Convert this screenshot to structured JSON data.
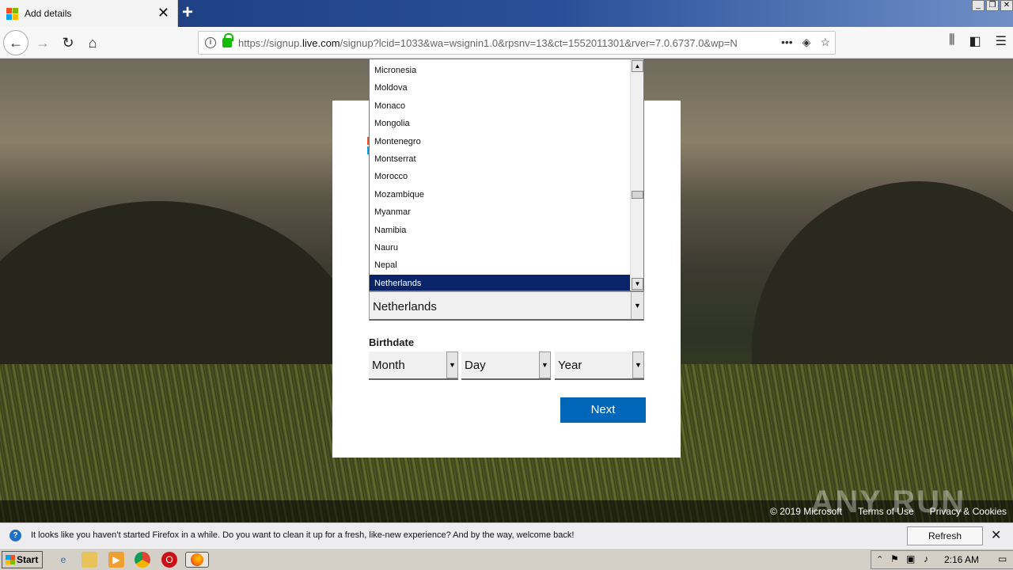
{
  "browser": {
    "tab_title": "Add details",
    "url_prefix": "https://signup.",
    "url_domain": "live.com",
    "url_rest": "/signup?lcid=1033&wa=wsignin1.0&rpsnv=13&ct=1552011301&rver=7.0.6737.0&wp=N"
  },
  "dropdown": {
    "items": [
      "Micronesia",
      "Moldova",
      "Monaco",
      "Mongolia",
      "Montenegro",
      "Montserrat",
      "Morocco",
      "Mozambique",
      "Myanmar",
      "Namibia",
      "Nauru",
      "Nepal",
      "Netherlands"
    ],
    "selected": "Netherlands"
  },
  "form": {
    "country_value": "Netherlands",
    "birthdate_label": "Birthdate",
    "month": "Month",
    "day": "Day",
    "year": "Year",
    "next_label": "Next"
  },
  "page_footer": {
    "copyright": "© 2019 Microsoft",
    "terms": "Terms of Use",
    "privacy": "Privacy & Cookies"
  },
  "watermark": "ANY RUN",
  "notification": {
    "message": "It looks like you haven’t started Firefox in a while. Do you want to clean it up for a fresh, like-new experience? And by the way, welcome back!",
    "button": "Refresh Firefox…"
  },
  "taskbar": {
    "start_label": "Start",
    "clock": "2:16 AM"
  },
  "colors": {
    "accent": "#0067b8",
    "selection": "#0a246a"
  }
}
